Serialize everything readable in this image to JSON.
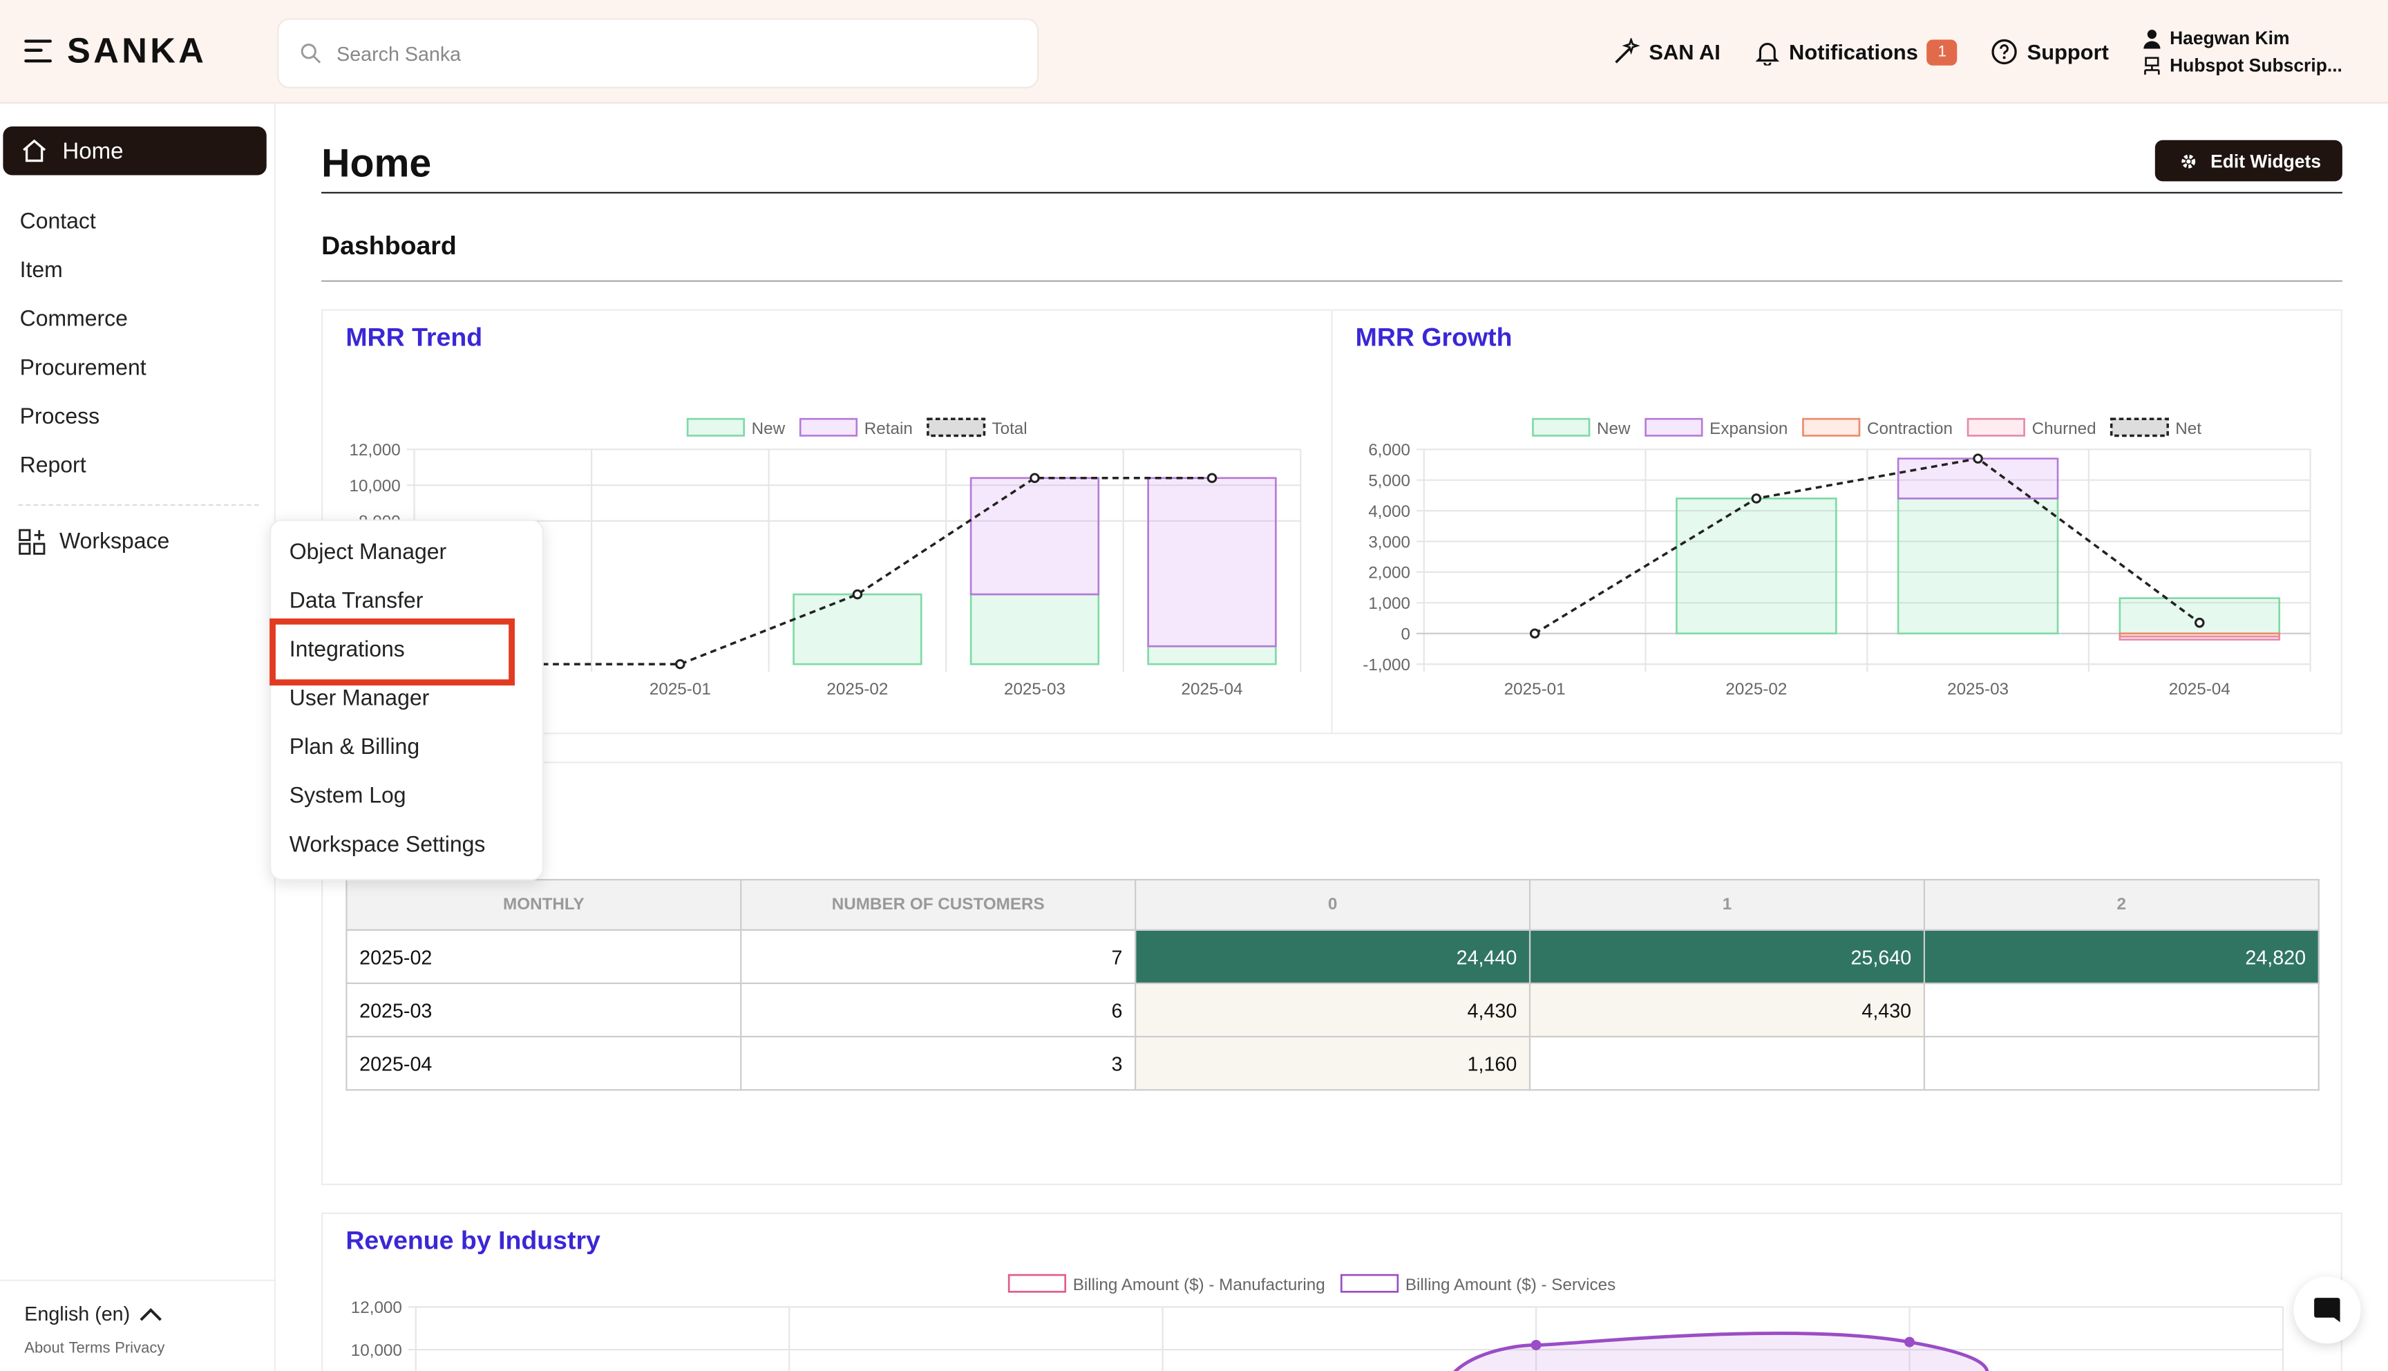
{
  "app": {
    "brand": "SANKA"
  },
  "search": {
    "placeholder": "Search Sanka"
  },
  "header": {
    "san_ai": "SAN AI",
    "notifications": "Notifications",
    "notif_count": "1",
    "support": "Support",
    "user_name": "Haegwan Kim",
    "workspace_name": "Hubspot Subscrip..."
  },
  "sidebar": {
    "home": "Home",
    "items": [
      "Contact",
      "Item",
      "Commerce",
      "Procurement",
      "Process",
      "Report"
    ],
    "workspace": "Workspace",
    "language": "English (en)",
    "legal": [
      "About",
      "Terms",
      "Privacy"
    ]
  },
  "workspace_menu": {
    "items": [
      "Object Manager",
      "Data Transfer",
      "Integrations",
      "User Manager",
      "Plan & Billing",
      "System Log",
      "Workspace Settings"
    ],
    "highlighted": "Integrations"
  },
  "main": {
    "title": "Home",
    "edit_widgets": "Edit Widgets",
    "dashboard": "Dashboard"
  },
  "colors": {
    "accent_title": "#3a27d6",
    "dark": "#1f1410",
    "topbar": "#fdf3ef",
    "heat_dark": "#2f7562",
    "highlight": "#e23b22"
  },
  "chart_data": [
    {
      "type": "bar",
      "title": "MRR Trend",
      "categories": [
        "2025-01",
        "2025-02",
        "2025-03",
        "2025-04"
      ],
      "series": [
        {
          "name": "New",
          "values": [
            0,
            3900,
            3900,
            1000
          ]
        },
        {
          "name": "Retain",
          "values": [
            0,
            0,
            6500,
            9400
          ]
        },
        {
          "name": "Total",
          "values": [
            0,
            3900,
            10400,
            10400
          ],
          "kind": "line"
        }
      ],
      "yticks": [
        "12,000",
        "10,000",
        "8,000"
      ],
      "ylim": [
        0,
        12000
      ]
    },
    {
      "type": "bar",
      "title": "MRR Growth",
      "categories": [
        "2025-01",
        "2025-02",
        "2025-03",
        "2025-04"
      ],
      "series": [
        {
          "name": "New",
          "values": [
            0,
            4400,
            4400,
            1150
          ]
        },
        {
          "name": "Expansion",
          "values": [
            0,
            0,
            1300,
            0
          ]
        },
        {
          "name": "Contraction",
          "values": [
            0,
            0,
            0,
            -100
          ]
        },
        {
          "name": "Churned",
          "values": [
            0,
            0,
            0,
            -100
          ]
        },
        {
          "name": "Net",
          "values": [
            0,
            4400,
            5700,
            350
          ],
          "kind": "line"
        }
      ],
      "yticks": [
        "6,000",
        "5,000",
        "4,000",
        "3,000",
        "2,000",
        "1,000",
        "0",
        "-1,000"
      ],
      "ylim": [
        -1000,
        6000
      ]
    },
    {
      "type": "table",
      "columns": [
        "MONTHLY",
        "NUMBER OF CUSTOMERS",
        "0",
        "1",
        "2"
      ],
      "rows": [
        [
          "2025-02",
          "7",
          "24,440",
          "25,640",
          "24,820"
        ],
        [
          "2025-03",
          "6",
          "4,430",
          "4,430",
          ""
        ],
        [
          "2025-04",
          "3",
          "1,160",
          "",
          ""
        ]
      ]
    },
    {
      "type": "area",
      "title": "Revenue by Industry",
      "series": [
        {
          "name": "Billing Amount ($) - Manufacturing"
        },
        {
          "name": "Billing Amount ($) - Services"
        }
      ],
      "yticks": [
        "12,000",
        "10,000"
      ],
      "ylim": [
        0,
        12000
      ]
    }
  ]
}
